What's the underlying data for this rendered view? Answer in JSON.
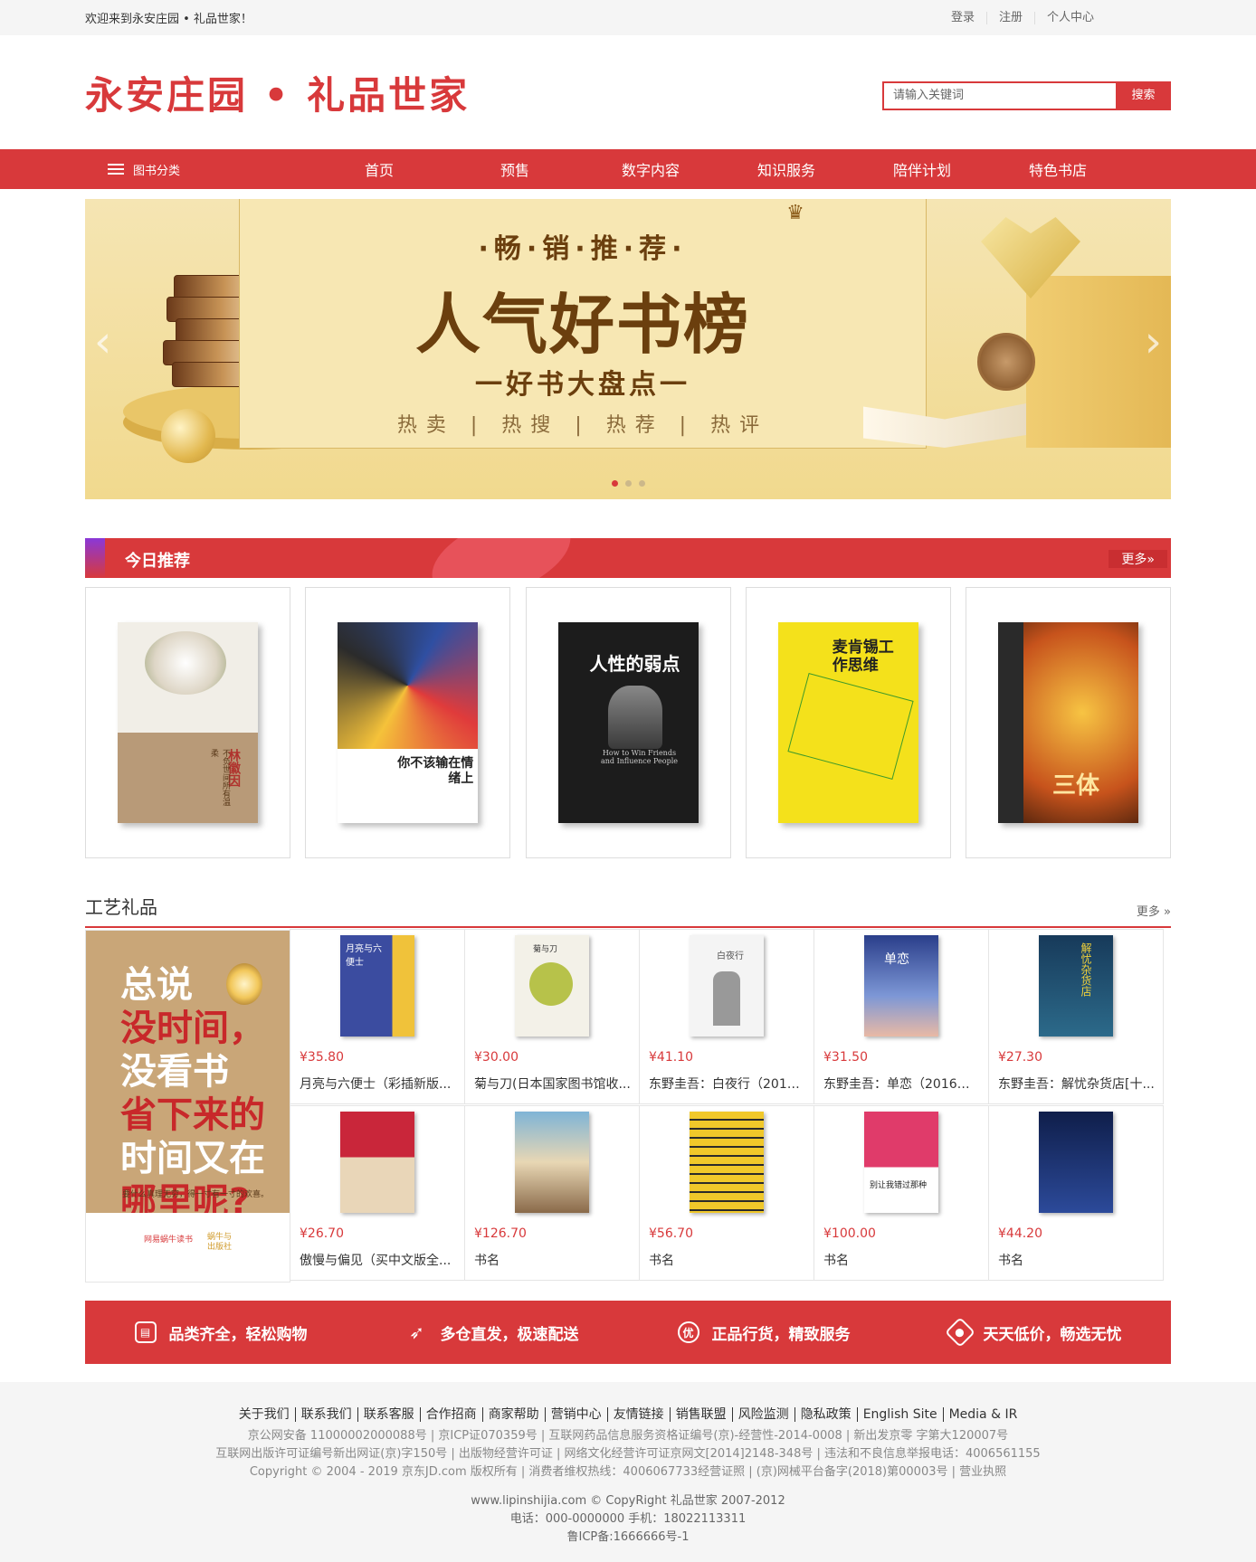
{
  "topbar": {
    "welcome": "欢迎来到永安庄园 • 礼品世家！",
    "login": "登录",
    "register": "注册",
    "user_center": "个人中心"
  },
  "header": {
    "logo": "永安庄园 • 礼品世家",
    "search_placeholder": "请输入关键词",
    "search_button": "搜索"
  },
  "nav": {
    "category": "图书分类",
    "items": [
      "首页",
      "预售",
      "数字内容",
      "知识服务",
      "陪伴计划",
      "特色书店"
    ]
  },
  "banner": {
    "subtitle": "·畅·销·推·荐·",
    "title": "人气好书榜",
    "tagline": "一好书大盘点一",
    "tags": "热卖 | 热搜 | 热荐 | 热评"
  },
  "recommend": {
    "title": "今日推荐",
    "more": "更多»",
    "covers": [
      {
        "title": "林徽因",
        "sub": "不负世间所有温柔"
      },
      {
        "title": "你不该输在情绪上",
        "sub": ""
      },
      {
        "title": "人性的弱点",
        "sub": "How to Win Friends and Influence People"
      },
      {
        "title": "麦肯锡工作思维",
        "sub": ""
      },
      {
        "title": "三体",
        "sub": ""
      }
    ]
  },
  "crafts": {
    "title": "工艺礼品",
    "more": "更多 »",
    "poster": {
      "line1": "总说",
      "line2": "没时间，",
      "line3": "没看书",
      "line4": "省下来的",
      "line5": "时间又在",
      "line6": "哪里呢?",
      "small": "要什么真理无穷，得一寸有一寸的欢喜。",
      "brand": "网易蜗牛读书",
      "brand2": "蜗牛与\n出版社"
    },
    "items": [
      {
        "price": "¥35.80",
        "name": "月亮与六便士（彩插新版...",
        "cover": "月亮与六便士"
      },
      {
        "price": "¥30.00",
        "name": "菊与刀(日本国家图书馆收...",
        "cover": "菊与刀"
      },
      {
        "price": "¥41.10",
        "name": "东野圭吾：白夜行（2017...",
        "cover": "白夜行"
      },
      {
        "price": "¥31.50",
        "name": "东野圭吾：单恋（2016版...",
        "cover": "单恋"
      },
      {
        "price": "¥27.30",
        "name": "东野圭吾：解忧杂货店[十...",
        "cover": "解忧杂货店"
      },
      {
        "price": "¥26.70",
        "name": "傲慢与偏见（买中文版全...",
        "cover": ""
      },
      {
        "price": "¥126.70",
        "name": "书名",
        "cover": ""
      },
      {
        "price": "¥56.70",
        "name": "书名",
        "cover": ""
      },
      {
        "price": "¥100.00",
        "name": "书名",
        "cover": "别让我错过那种"
      },
      {
        "price": "¥44.20",
        "name": "书名",
        "cover": ""
      }
    ]
  },
  "features": [
    {
      "icon": "bag-icon",
      "text": "品类齐全，轻松购物"
    },
    {
      "icon": "rocket-icon",
      "text": "多仓直发，极速配送"
    },
    {
      "icon": "quality-icon",
      "text": "正品行货，精致服务"
    },
    {
      "icon": "tag-icon",
      "text": "天天低价，畅选无忧"
    }
  ],
  "footer": {
    "links": [
      "关于我们",
      "联系我们",
      "联系客服",
      "合作招商",
      "商家帮助",
      "营销中心",
      "友情链接",
      "销售联盟",
      "风险监测",
      "隐私政策",
      "English Site",
      "Media & IR"
    ],
    "line1": "京公网安备 11000002000088号 | 京ICP证070359号 | 互联网药品信息服务资格证编号(京)-经营性-2014-0008 | 新出发京零 字第大120007号",
    "line2": "互联网出版许可证编号新出网证(京)字150号 | 出版物经营许可证 | 网络文化经营许可证京网文[2014]2148-348号 | 违法和不良信息举报电话：4006561155",
    "line3": "Copyright © 2004 - 2019 京东JD.com 版权所有 | 消费者维权热线：4006067733经营证照 | (京)网械平台备字(2018)第00003号 | 营业执照",
    "line4": "www.lipinshijia.com © CopyRight 礼品世家 2007-2012",
    "line5": "电话：000-0000000 手机：18022113311",
    "line6": "鲁ICP备:1666666号-1"
  }
}
